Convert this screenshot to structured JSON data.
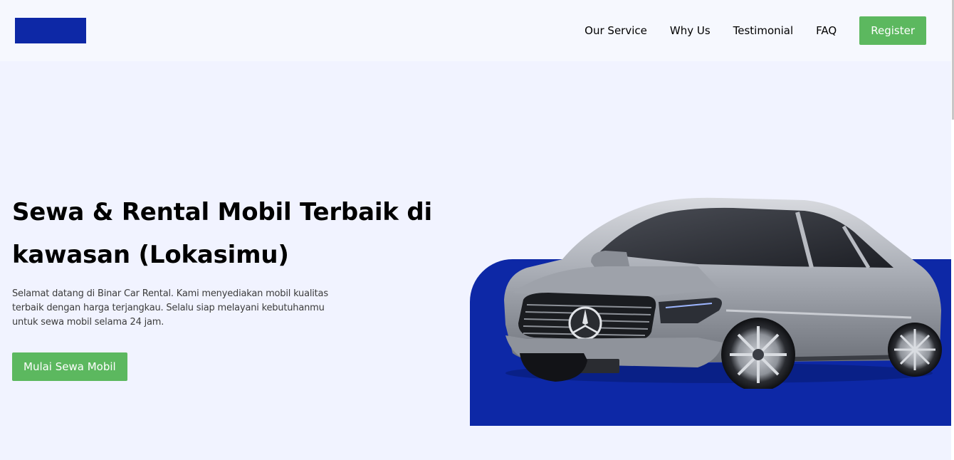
{
  "navbar": {
    "links": [
      "Our Service",
      "Why Us",
      "Testimonial",
      "FAQ"
    ],
    "register_label": "Register"
  },
  "hero": {
    "title": "Sewa & Rental Mobil Terbaik di kawasan (Lokasimu)",
    "description": "Selamat datang di Binar Car Rental. Kami menyediakan mobil kualitas terbaik dengan harga terjangkau. Selalu siap melayani kebutuhanmu untuk sewa mobil selama 24 jam.",
    "cta_label": "Mulai Sewa Mobil"
  },
  "colors": {
    "brand_blue": "#0D28A6",
    "accent_green": "#5CB85F",
    "hero_background": "#F1F3FF",
    "navbar_background": "#F6F8FE"
  },
  "icons": {
    "logo": "logo-block",
    "car_image": "mercedes-suv-car"
  }
}
